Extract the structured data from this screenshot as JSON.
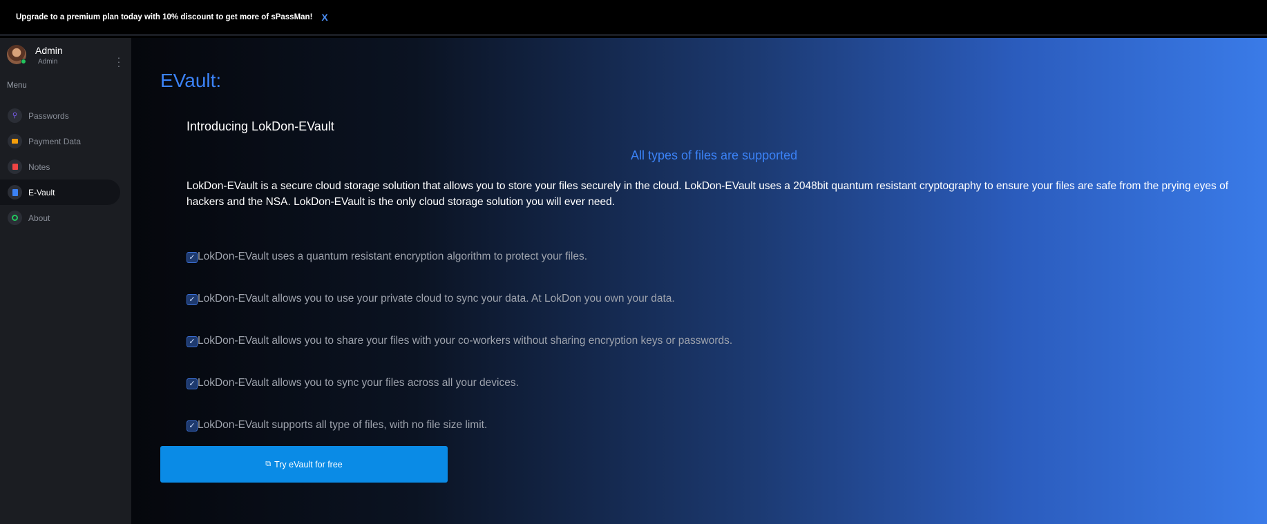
{
  "banner": {
    "text": "Upgrade to a premium plan today with 10% discount to get more of sPassMan!",
    "close_label": "X"
  },
  "profile": {
    "name": "Admin",
    "role": "Admin",
    "status_color": "#22c55e"
  },
  "sidebar": {
    "menu_label": "Menu",
    "items": [
      {
        "label": "Passwords",
        "icon": "key-icon",
        "color": "#7c5cf0",
        "active": false
      },
      {
        "label": "Payment Data",
        "icon": "credit-card-icon",
        "color": "#f59e0b",
        "active": false
      },
      {
        "label": "Notes",
        "icon": "note-icon",
        "color": "#ef4444",
        "active": false
      },
      {
        "label": "E-Vault",
        "icon": "file-icon",
        "color": "#3b82f6",
        "active": true
      },
      {
        "label": "About",
        "icon": "info-icon",
        "color": "#22c55e",
        "active": false
      }
    ]
  },
  "main": {
    "title": "EVault:",
    "intro": "Introducing LokDon-EVault",
    "subhead": "All types of files are supported",
    "description": "LokDon-EVault is a secure cloud storage solution that allows you to store your files securely in the cloud. LokDon-EVault uses a 2048bit quantum resistant cryptography to ensure your files are safe from the prying eyes of hackers and the NSA. LokDon-EVault is the only cloud storage solution you will ever need.",
    "features": [
      "LokDon-EVault uses a quantum resistant encryption algorithm to protect your files.",
      "LokDon-EVault allows you to use your private cloud to sync your data. At LokDon you own your data.",
      "LokDon-EVault allows you to share your files with your co-workers without sharing encryption keys or passwords.",
      "LokDon-EVault allows you to sync your files across all your devices.",
      "LokDon-EVault supports all type of files, with no file size limit."
    ],
    "cta_label": "Try eVault for free"
  },
  "colors": {
    "accent": "#3b82f6",
    "cta": "#0a8be6"
  }
}
